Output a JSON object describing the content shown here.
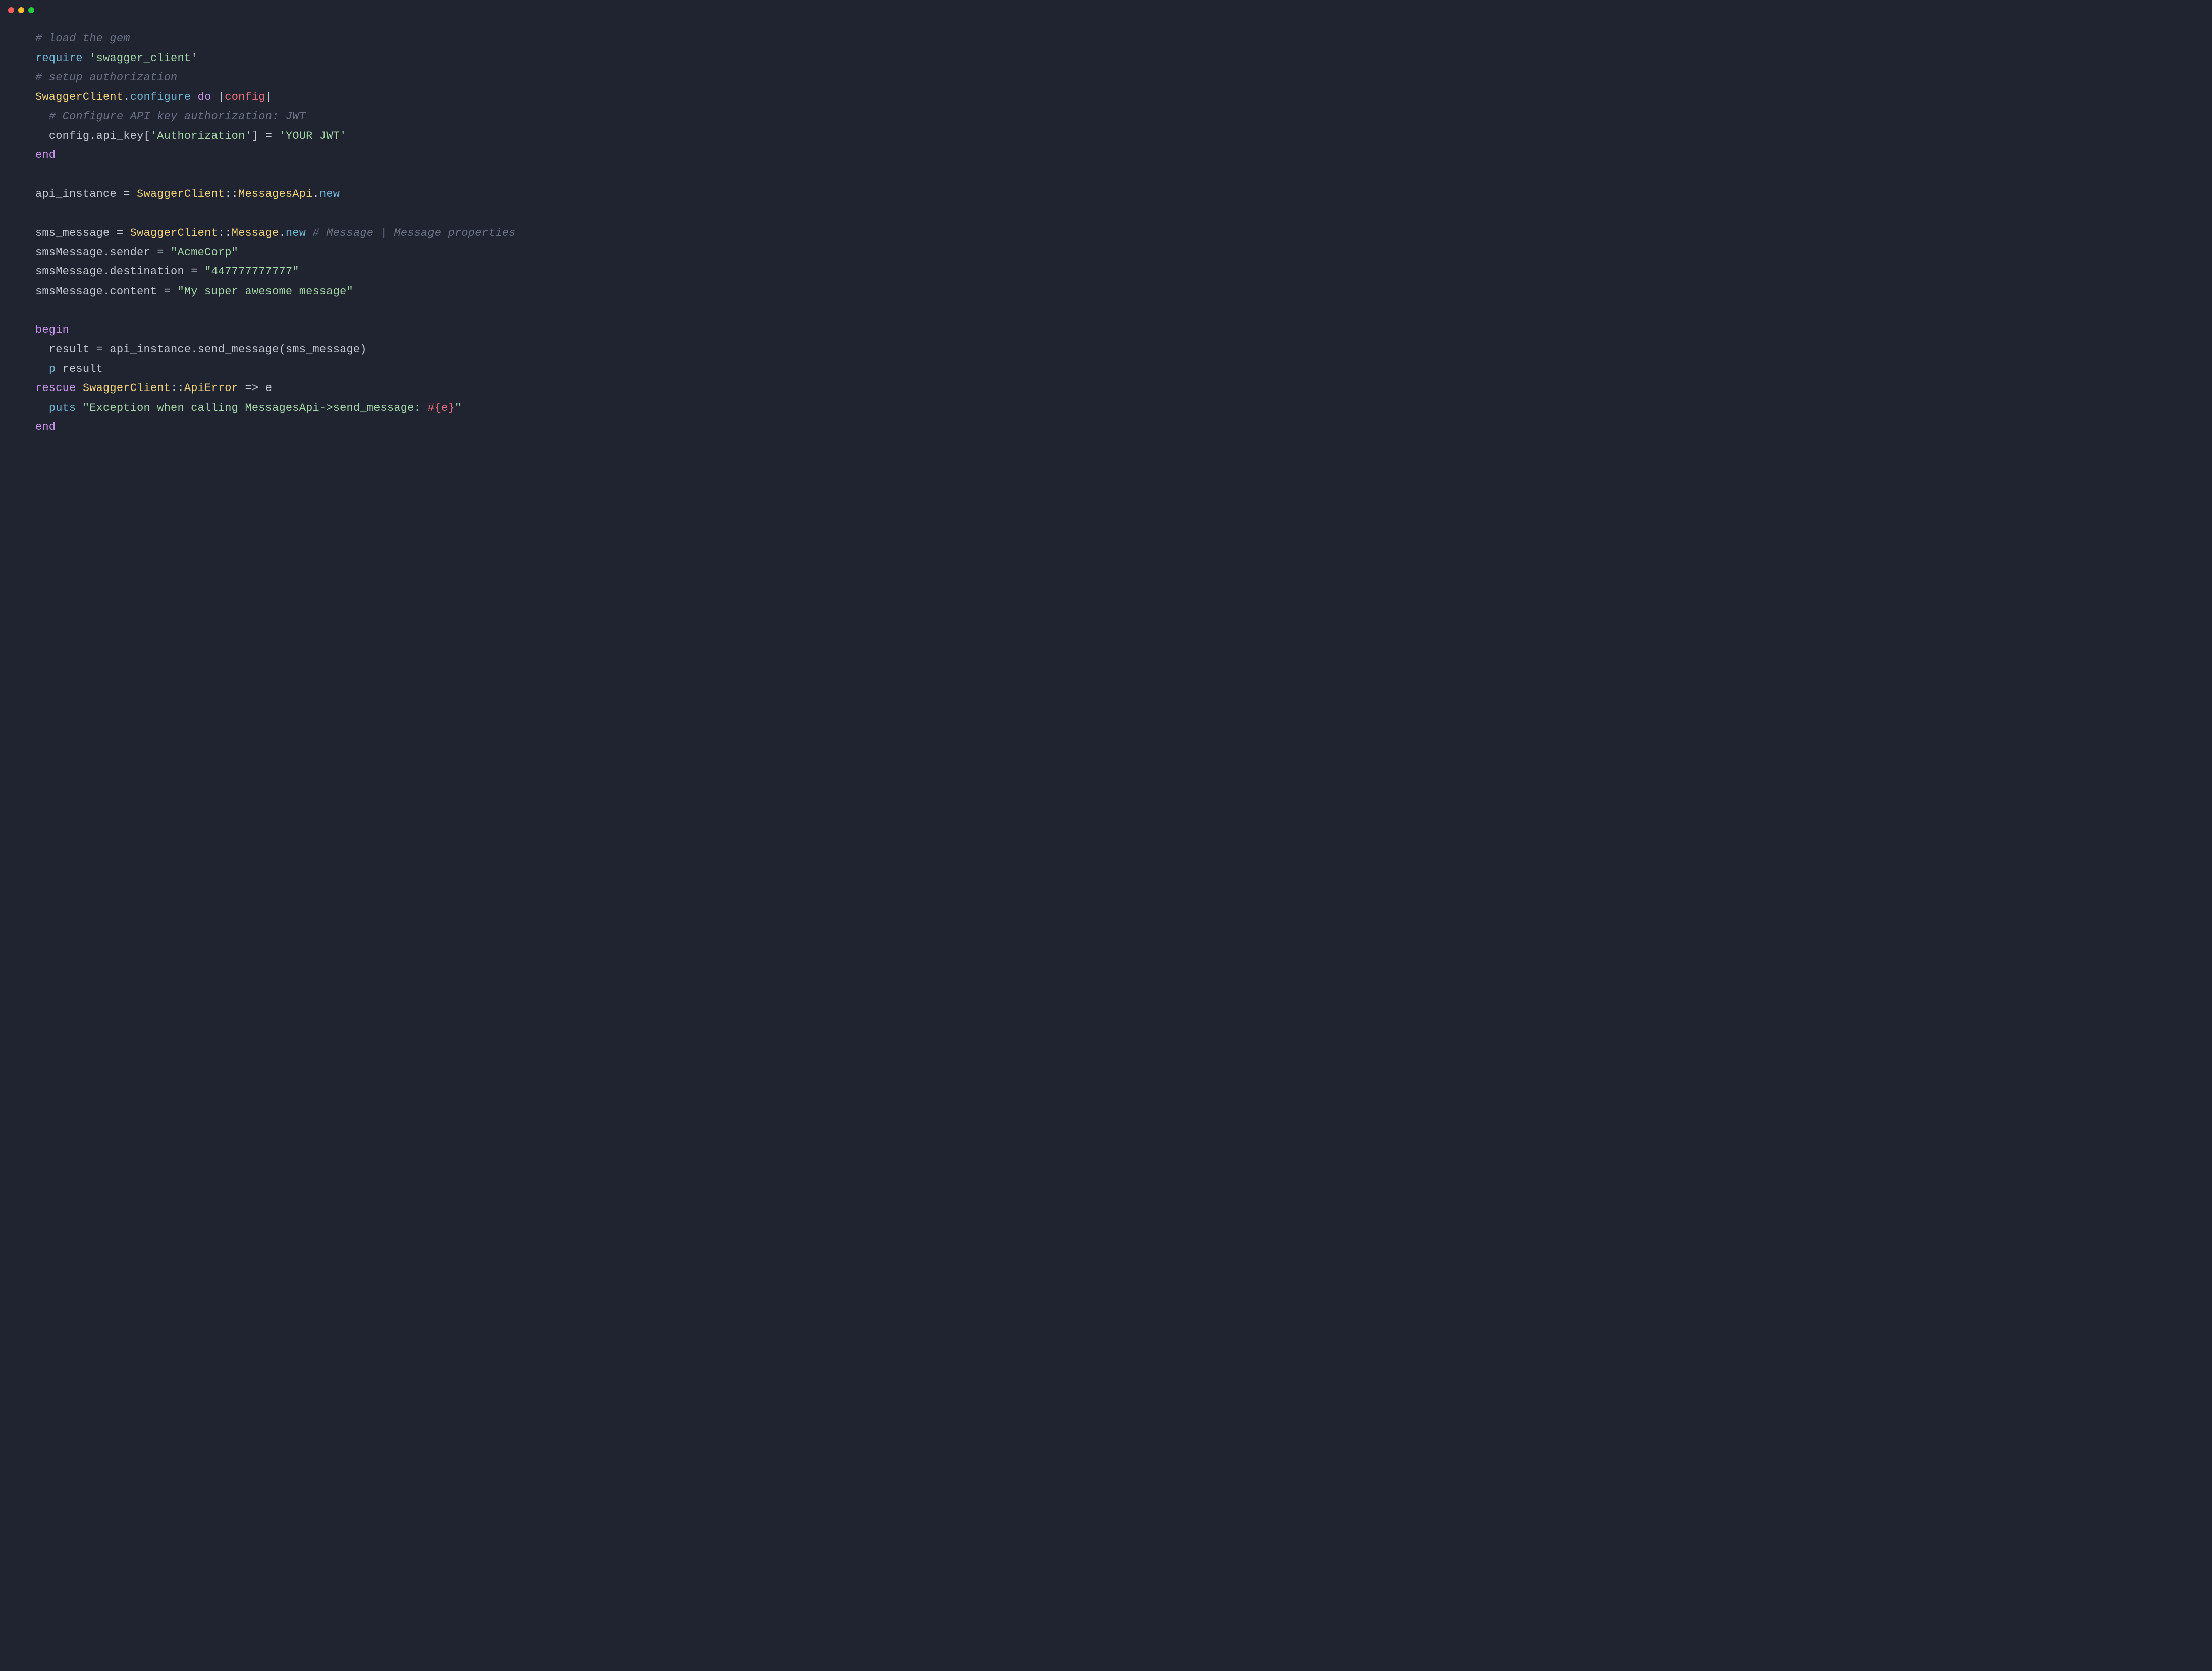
{
  "window": {
    "traffic_lights": {
      "red": "#ff5f56",
      "yellow": "#ffbd2e",
      "green": "#27c93f"
    }
  },
  "code": {
    "l1": {
      "comment": "# load the gem"
    },
    "l2": {
      "require": "require",
      "space": " ",
      "str": "'swagger_client'"
    },
    "l3": {
      "comment": "# setup authorization"
    },
    "l4": {
      "const": "SwaggerClient",
      "dot": ".",
      "method": "configure",
      "sp1": " ",
      "do": "do",
      "sp2": " ",
      "pipe1": "|",
      "param": "config",
      "pipe2": "|"
    },
    "l5": {
      "indent": "  ",
      "comment": "# Configure API key authorization: JWT"
    },
    "l6": {
      "indent": "  ",
      "ident": "config.api_key[",
      "str1": "'Authorization'",
      "close": "] = ",
      "str2": "'YOUR JWT'"
    },
    "l7": {
      "end": "end"
    },
    "l8": {
      "blank": " "
    },
    "l9": {
      "ident": "api_instance = ",
      "const1": "SwaggerClient",
      "::": "::",
      "const2": "MessagesApi",
      "dot": ".",
      "new": "new"
    },
    "l10": {
      "blank": " "
    },
    "l11": {
      "ident": "sms_message = ",
      "const1": "SwaggerClient",
      "::": "::",
      "const2": "Message",
      "dot": ".",
      "new": "new",
      "sp": " ",
      "comment": "# Message | Message properties"
    },
    "l12": {
      "ident": "smsMessage.sender = ",
      "str": "\"AcmeCorp\""
    },
    "l13": {
      "ident": "smsMessage.destination = ",
      "str": "\"447777777777\""
    },
    "l14": {
      "ident": "smsMessage.content = ",
      "str": "\"My super awesome message\""
    },
    "l15": {
      "blank": " "
    },
    "l16": {
      "begin": "begin"
    },
    "l17": {
      "indent": "  ",
      "ident": "result = api_instance.send_message(sms_message)"
    },
    "l18": {
      "indent": "  ",
      "p": "p",
      "sp": " ",
      "ident": "result"
    },
    "l19": {
      "rescue": "rescue",
      "sp1": " ",
      "const1": "SwaggerClient",
      "::": "::",
      "const2": "ApiError",
      "sp2": " ",
      "arrow": "=>",
      "sp3": " ",
      "e": "e"
    },
    "l20": {
      "indent": "  ",
      "puts": "puts",
      "sp": " ",
      "str1": "\"Exception when calling MessagesApi->send_message: ",
      "interp": "#{e}",
      "str2": "\""
    },
    "l21": {
      "end": "end"
    }
  }
}
